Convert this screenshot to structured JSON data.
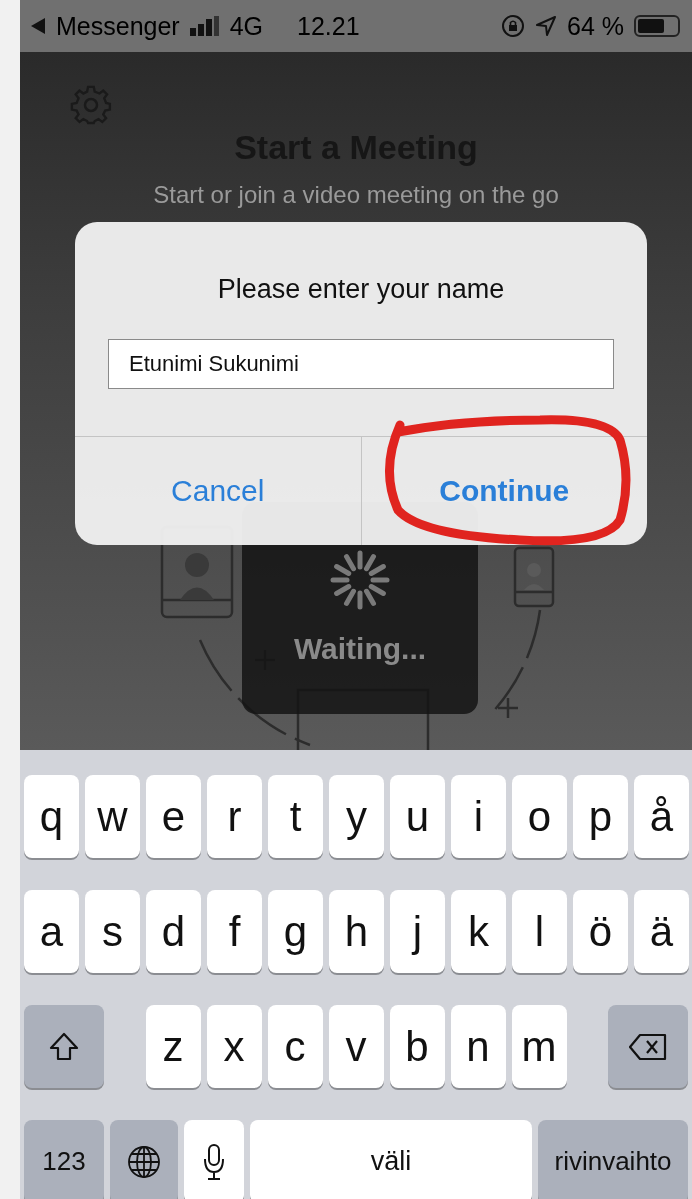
{
  "status_bar": {
    "back_app": "Messenger",
    "network": "4G",
    "time": "12.21",
    "battery": "64 %"
  },
  "app": {
    "title": "Start a Meeting",
    "subtitle": "Start or join a video meeting on the go"
  },
  "hud": {
    "label": "Waiting..."
  },
  "dialog": {
    "title": "Please enter your name",
    "field": {
      "value": "Etunimi Sukunimi"
    },
    "buttons": [
      {
        "label": "Cancel",
        "kind": "cancel",
        "highlighted": false
      },
      {
        "label": "Continue",
        "kind": "default",
        "highlighted": true
      }
    ]
  },
  "keyboard": {
    "rows": [
      {
        "keys": [
          {
            "label": "q",
            "kind": "letter"
          },
          {
            "label": "w",
            "kind": "letter"
          },
          {
            "label": "e",
            "kind": "letter"
          },
          {
            "label": "r",
            "kind": "letter"
          },
          {
            "label": "t",
            "kind": "letter"
          },
          {
            "label": "y",
            "kind": "letter"
          },
          {
            "label": "u",
            "kind": "letter"
          },
          {
            "label": "i",
            "kind": "letter"
          },
          {
            "label": "o",
            "kind": "letter"
          },
          {
            "label": "p",
            "kind": "letter"
          },
          {
            "label": "å",
            "kind": "letter"
          }
        ]
      },
      {
        "keys": [
          {
            "label": "a",
            "kind": "letter"
          },
          {
            "label": "s",
            "kind": "letter"
          },
          {
            "label": "d",
            "kind": "letter"
          },
          {
            "label": "f",
            "kind": "letter"
          },
          {
            "label": "g",
            "kind": "letter"
          },
          {
            "label": "h",
            "kind": "letter"
          },
          {
            "label": "j",
            "kind": "letter"
          },
          {
            "label": "k",
            "kind": "letter"
          },
          {
            "label": "l",
            "kind": "letter"
          },
          {
            "label": "ö",
            "kind": "letter"
          },
          {
            "label": "ä",
            "kind": "letter"
          }
        ]
      },
      {
        "keys": [
          {
            "kind": "shift"
          },
          {
            "label": "z",
            "kind": "letter"
          },
          {
            "label": "x",
            "kind": "letter"
          },
          {
            "label": "c",
            "kind": "letter"
          },
          {
            "label": "v",
            "kind": "letter"
          },
          {
            "label": "b",
            "kind": "letter"
          },
          {
            "label": "n",
            "kind": "letter"
          },
          {
            "label": "m",
            "kind": "letter"
          },
          {
            "kind": "backspace"
          }
        ]
      },
      {
        "keys": [
          {
            "label": "123",
            "kind": "numbers"
          },
          {
            "kind": "globe"
          },
          {
            "kind": "mic"
          },
          {
            "label": "väli",
            "kind": "space"
          },
          {
            "label": "rivinvaihto",
            "kind": "return"
          }
        ]
      }
    ]
  }
}
